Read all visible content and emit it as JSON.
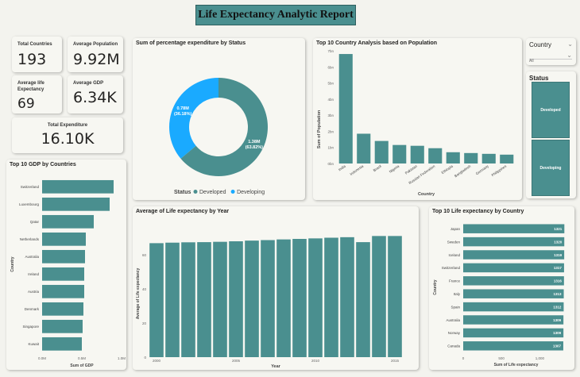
{
  "report": {
    "title": "Life Expectancy Analytic Report"
  },
  "kpis": {
    "total_countries": {
      "label": "Total Countries",
      "value": "193"
    },
    "average_population": {
      "label": "Average Population",
      "value": "9.92M"
    },
    "average_life_expectancy": {
      "label": "Average life Expectancy",
      "value": "69"
    },
    "average_gdp": {
      "label": "Average GDP",
      "value": "6.34K"
    },
    "total_expenditure": {
      "label": "Total Expenditure",
      "value": "16.10K"
    }
  },
  "slicers": {
    "country": {
      "label": "Country",
      "value": "All"
    },
    "status": {
      "label": "Status",
      "options": [
        "Developed",
        "Developing"
      ]
    }
  },
  "colors": {
    "teal": "#4a8f8f",
    "blue": "#1aaaff",
    "accent": "#4a8f8f"
  },
  "chart_data": [
    {
      "id": "donut",
      "type": "pie",
      "title": "Sum of percentage expenditure by Status",
      "legend_title": "Status",
      "legend_position": "bottom",
      "slices": [
        {
          "name": "Developed",
          "value": 1.38,
          "label": "1.38M",
          "pct": "(63.82%)",
          "color": "#4a8f8f"
        },
        {
          "name": "Developing",
          "value": 0.78,
          "label": "0.78M",
          "pct": "(36.18%)",
          "color": "#1aaaff"
        }
      ]
    },
    {
      "id": "population",
      "type": "bar",
      "title": "Top 10 Country Analysis based on Population",
      "xlabel": "Country",
      "ylabel": "Sum of Population",
      "categories": [
        "India",
        "Indonesia",
        "Brazil",
        "Nigeria",
        "Pakistan",
        "Russian Federation",
        "Ethiopia",
        "Bangladesh",
        "Germany",
        "Philippines"
      ],
      "values": [
        68,
        18.5,
        14,
        11.5,
        11,
        9.5,
        7,
        6.5,
        6,
        5.5
      ],
      "yticks": [
        "0bn",
        "1bn",
        "2bn",
        "3bn",
        "4bn",
        "5bn",
        "6bn",
        "7bn"
      ],
      "ylim": [
        0,
        70
      ]
    },
    {
      "id": "gdp",
      "type": "bar",
      "orientation": "horizontal",
      "title": "Top 10 GDP by Countries",
      "xlabel": "Sum of GDP",
      "ylabel": "Country",
      "categories": [
        "Switzerland",
        "Luxembourg",
        "Qatar",
        "Netherlands",
        "Australia",
        "Ireland",
        "Austria",
        "Denmark",
        "Singapore",
        "Kuwait"
      ],
      "values": [
        0.9,
        0.85,
        0.65,
        0.55,
        0.54,
        0.53,
        0.53,
        0.52,
        0.51,
        0.5
      ],
      "xticks": [
        "0.0M",
        "0.5M",
        "1.0M"
      ],
      "xlim": [
        0,
        1.0
      ]
    },
    {
      "id": "life_year",
      "type": "bar",
      "title": "Average of Life expectancy by Year",
      "xlabel": "Year",
      "ylabel": "Average of Life expectancy",
      "categories": [
        "2000",
        "2001",
        "2002",
        "2003",
        "2004",
        "2005",
        "2006",
        "2007",
        "2008",
        "2009",
        "2010",
        "2011",
        "2012",
        "2013",
        "2014",
        "2015"
      ],
      "values": [
        66.8,
        67.1,
        67.3,
        67.4,
        67.6,
        67.9,
        68.3,
        68.6,
        69.0,
        69.3,
        69.6,
        70.0,
        70.3,
        67.4,
        71.0,
        71.0
      ],
      "xticks": [
        "2000",
        "2005",
        "2010",
        "2015"
      ],
      "yticks": [
        "0",
        "20",
        "40",
        "60"
      ],
      "ylim": [
        0,
        80
      ]
    },
    {
      "id": "life_country",
      "type": "bar",
      "orientation": "horizontal",
      "title": "Top 10 Life expectancy by Country",
      "xlabel": "Sum of Life expectancy",
      "ylabel": "Country",
      "categories": [
        "Japan",
        "Sweden",
        "Iceland",
        "Switzerland",
        "France",
        "Italy",
        "Spain",
        "Australia",
        "Norway",
        "Canada"
      ],
      "values": [
        1321,
        1320,
        1319,
        1317,
        1316,
        1313,
        1312,
        1309,
        1309,
        1307
      ],
      "data_labels": [
        "1321",
        "1320",
        "1319",
        "1317",
        "1316",
        "1313",
        "1312",
        "1309",
        "1309",
        "1307"
      ],
      "xticks": [
        "0",
        "500",
        "1,000"
      ],
      "xlim": [
        0,
        1380
      ]
    }
  ]
}
